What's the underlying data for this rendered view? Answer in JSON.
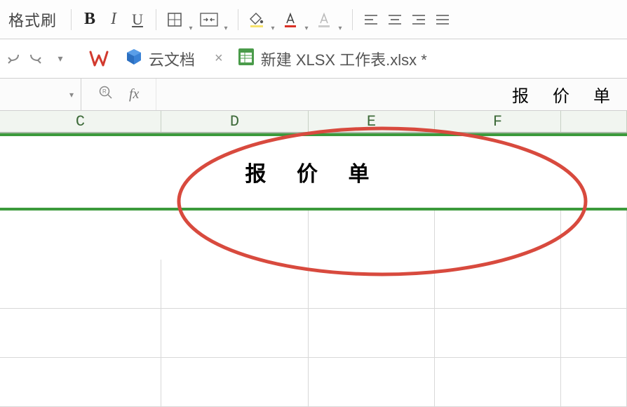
{
  "toolbar": {
    "format_brush_label": "格式刷",
    "bold_label": "B",
    "italic_label": "I",
    "underline_label": "U"
  },
  "tabs": {
    "cloud_doc_label": "云文档",
    "file_tab_label": "新建 XLSX 工作表.xlsx *"
  },
  "formula_bar": {
    "fx_label": "fx",
    "content": "报 价 单"
  },
  "columns": [
    "C",
    "D",
    "E",
    "F"
  ],
  "sheet": {
    "title_cell": "报 价 单"
  },
  "colors": {
    "accent_green": "#3c9a3c",
    "header_text": "#3e6b3a",
    "annotation_red": "#d84a3e"
  }
}
